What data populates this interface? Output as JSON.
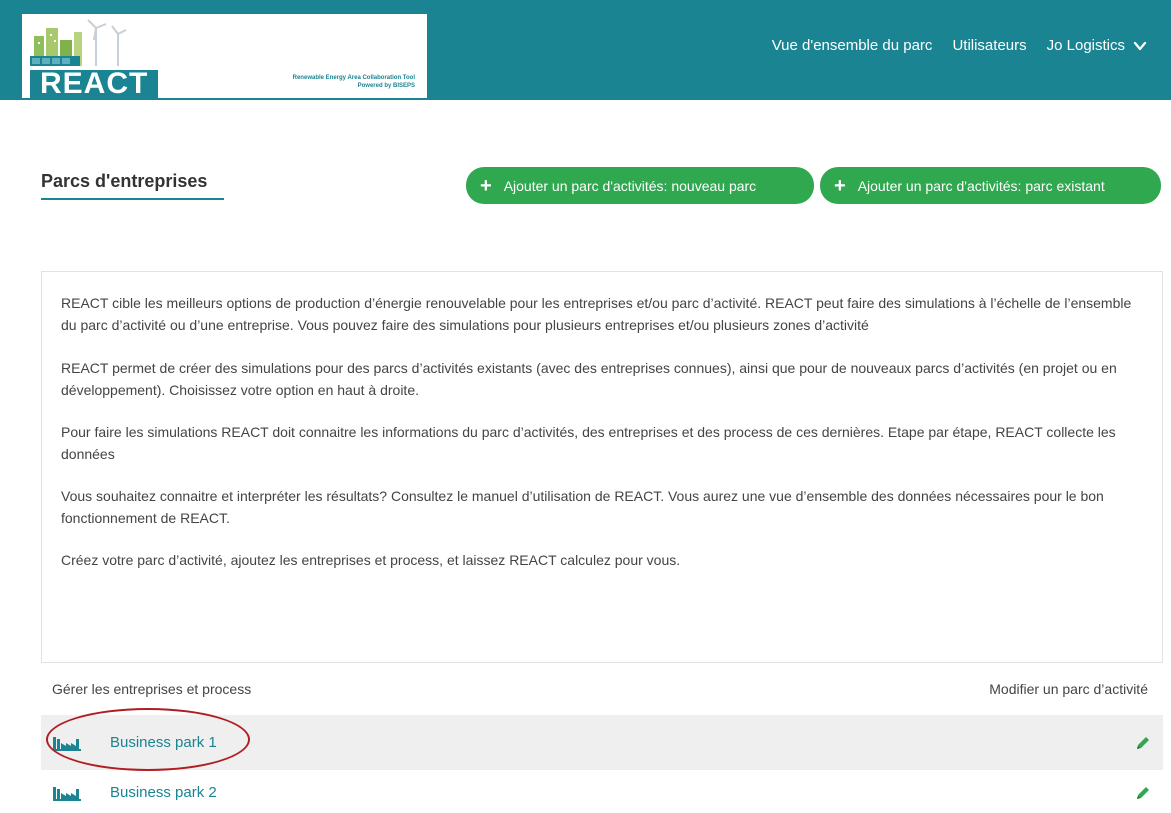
{
  "header": {
    "logo_text": "REACT",
    "logo_tagline_1": "Renewable Energy Area Collaboration Tool",
    "logo_tagline_2": "Powered by BISEPS",
    "nav": {
      "overview": "Vue d'ensemble du parc",
      "users": "Utilisateurs",
      "account": "Jo Logistics"
    }
  },
  "page": {
    "title": "Parcs d'entreprises",
    "buttons": {
      "new_park": "Ajouter un parc d'activités: nouveau parc",
      "existing_park": "Ajouter un parc d'activités: parc existant"
    }
  },
  "info": {
    "paragraphs": [
      "REACT cible les meilleurs options de production d’énergie renouvelable pour les entreprises et/ou parc d’activité. REACT peut faire des simulations à l’échelle de l’ensemble du parc d’activité ou d’une entreprise. Vous pouvez faire des simulations pour plusieurs entreprises et/ou plusieurs zones d’activité",
      "REACT permet de créer des simulations pour des parcs d’activités existants (avec des entreprises connues), ainsi que pour de nouveaux parcs d’activités (en projet ou en développement). Choisissez votre option en haut à droite.",
      "Pour faire les simulations REACT doit connaitre les informations du parc d’activités, des entreprises et des process de ces dernières. Etape par étape, REACT collecte les données",
      "Vous souhaitez connaitre et interpréter les résultats? Consultez le manuel d’utilisation de REACT. Vous aurez une vue d’ensemble des données nécessaires pour le bon fonctionnement de REACT.",
      "Créez votre parc d’activité, ajoutez les entreprises et process, et laissez REACT calculez pour vous."
    ]
  },
  "table": {
    "header_left": "Gérer les entreprises et process",
    "header_right": "Modifier un parc d’activité",
    "rows": [
      {
        "name": "Business park 1"
      },
      {
        "name": "Business park 2"
      }
    ]
  },
  "colors": {
    "brand": "#1a8493",
    "button_green": "#2fa84f",
    "highlight_circle": "#b01e23"
  },
  "icons": {
    "factory": "factory-icon",
    "edit": "pencil-icon",
    "chevron": "chevron-down-icon",
    "plus": "plus-icon"
  }
}
